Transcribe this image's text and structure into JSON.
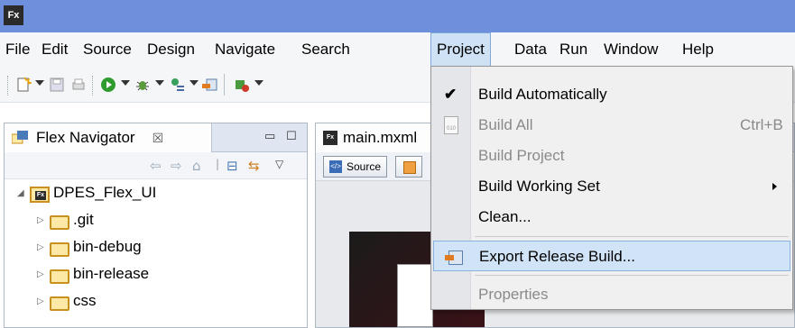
{
  "app": {
    "logo_text": "Fx"
  },
  "menubar": {
    "items": [
      "File",
      "Edit",
      "Source",
      "Design",
      "Navigate",
      "Search",
      "Project",
      "Data",
      "Run",
      "Window",
      "Help"
    ],
    "active": "Project"
  },
  "toolbar": {
    "icons": [
      "new-file-icon",
      "save-icon",
      "print-icon",
      "run-icon",
      "debug-icon",
      "profile-icon",
      "export-release-icon",
      "external-tools-icon"
    ]
  },
  "navigator": {
    "tab_label": "Flex Navigator",
    "close_glyph": "☒",
    "minimize_glyph": "▭",
    "maximize_glyph": "☐",
    "tools": [
      "back-arrow-icon",
      "forward-arrow-icon",
      "home-icon",
      "collapse-all-icon",
      "link-with-editor-icon",
      "view-menu-icon"
    ],
    "tree": [
      {
        "label": "DPES_Flex_UI",
        "expanded": true,
        "type": "project"
      },
      {
        "label": ".git",
        "expanded": false,
        "type": "folder"
      },
      {
        "label": "bin-debug",
        "expanded": false,
        "type": "folder"
      },
      {
        "label": "bin-release",
        "expanded": false,
        "type": "folder"
      },
      {
        "label": "css",
        "expanded": false,
        "type": "folder"
      }
    ]
  },
  "editor": {
    "tab_label": "main.mxml",
    "source_button": "Source"
  },
  "project_menu": {
    "items": [
      {
        "label": "Build Automatically",
        "checked": true,
        "enabled": true
      },
      {
        "label": "Build All",
        "shortcut": "Ctrl+B",
        "enabled": false
      },
      {
        "label": "Build Project",
        "enabled": false
      },
      {
        "label": "Build Working Set",
        "enabled": true,
        "submenu": true
      },
      {
        "label": "Clean...",
        "enabled": true
      },
      {
        "label": "Export Release Build...",
        "enabled": true,
        "highlighted": true
      },
      {
        "label": "Properties",
        "enabled": false
      }
    ],
    "check_glyph": "✔"
  },
  "colors": {
    "titlebar": "#6e8fdc",
    "menu_highlight": "#d1e3f7",
    "disabled_text": "#8a8a8a"
  }
}
